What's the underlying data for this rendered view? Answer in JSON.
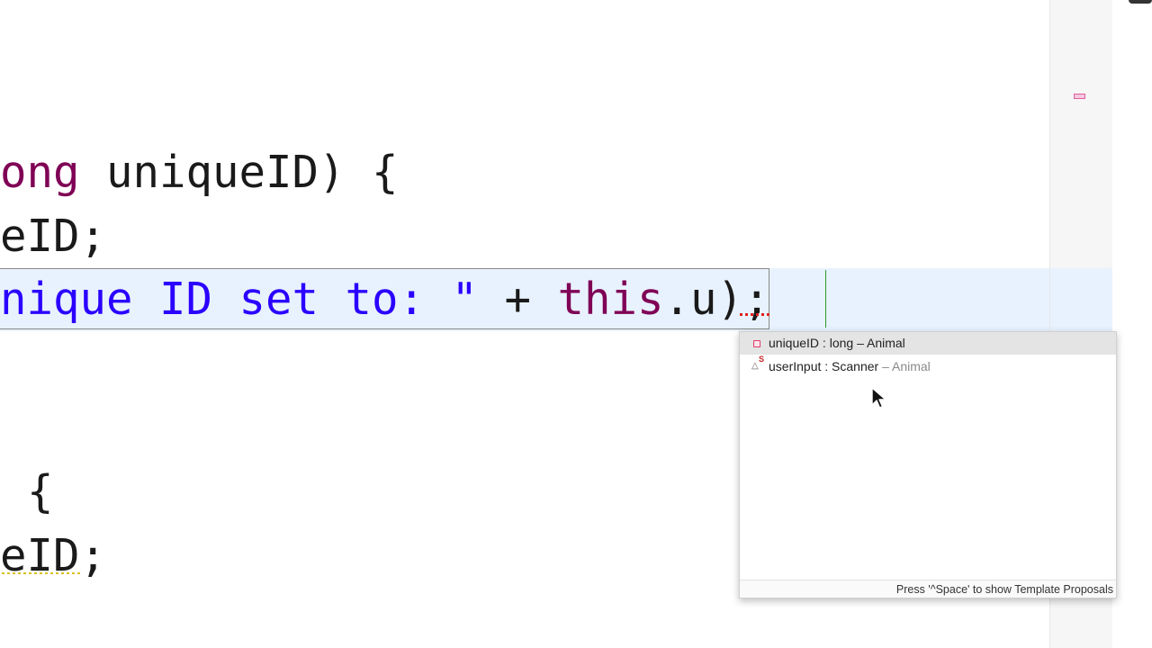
{
  "editor": {
    "lines": [
      {
        "kw": "ong",
        "text": " uniqueID) {"
      },
      {
        "text": "eID;"
      },
      {
        "str": "nique ID set to: \"",
        "mid": " + ",
        "kw": "this",
        "text": ".u);"
      },
      {
        "text": "{"
      },
      {
        "text": "eID;"
      }
    ]
  },
  "content_assist": {
    "proposals": [
      {
        "icon": "private-field-icon",
        "name": "uniqueID",
        "sep": " : ",
        "type": "long",
        "owner": " – Animal",
        "selected": true
      },
      {
        "icon": "static-field-icon",
        "name": "userInput",
        "sep": " : ",
        "type": "Scanner",
        "owner": " – Animal",
        "selected": false
      }
    ],
    "static_badge": "S",
    "status": "Press '^Space' to show Template Proposals"
  },
  "colors": {
    "keyword": "#7f0055",
    "string": "#2a00ff",
    "current_line": "#e8f2fe",
    "caret": "#2a9a2a",
    "error_squiggle": "#e02020"
  }
}
